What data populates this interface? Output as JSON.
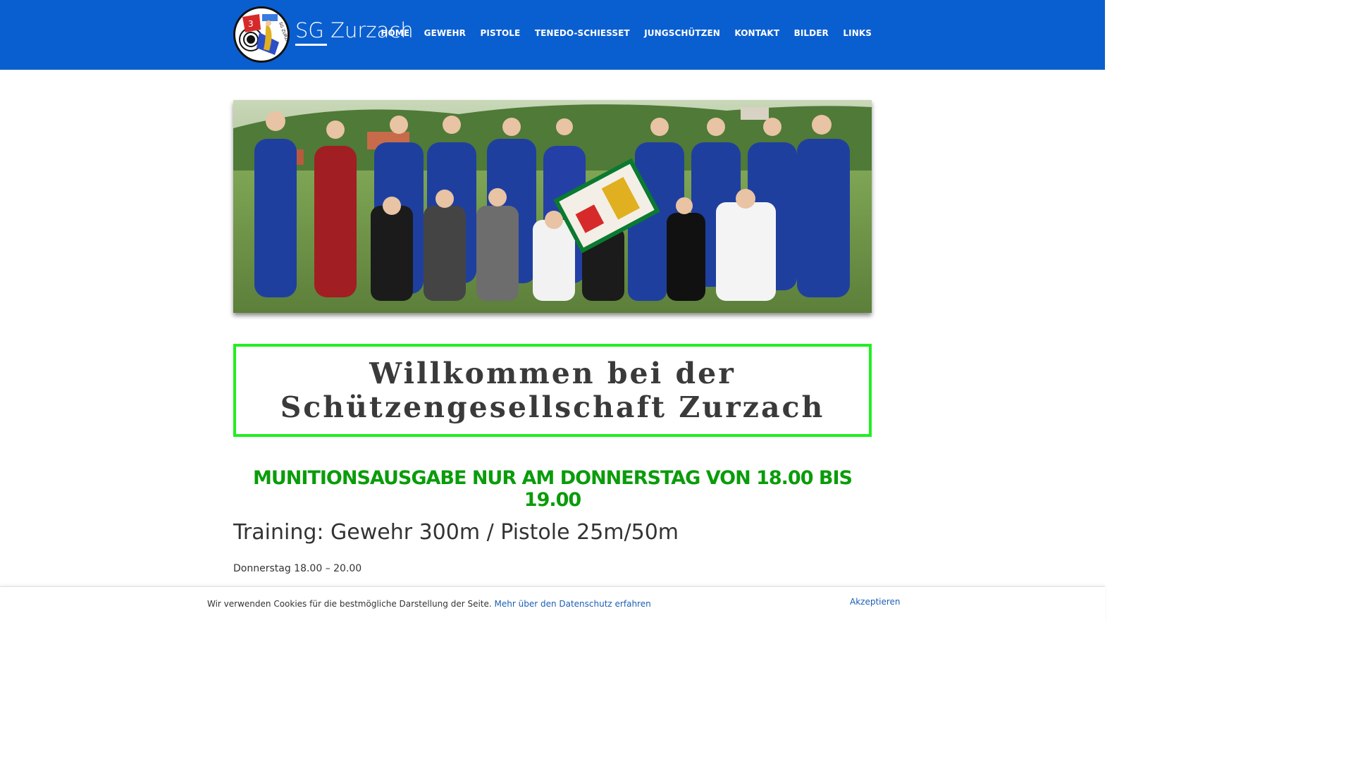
{
  "header": {
    "site_title": "SG Zurzach",
    "logo_text": "SG ZURZACH",
    "logo_number": "3",
    "nav": [
      {
        "label": "HOME"
      },
      {
        "label": "GEWEHR"
      },
      {
        "label": "PISTOLE"
      },
      {
        "label": "TENEDO-SCHIESSET"
      },
      {
        "label": "JUNGSCHÜTZEN"
      },
      {
        "label": "KONTAKT"
      },
      {
        "label": "BILDER"
      },
      {
        "label": "LINKS"
      }
    ]
  },
  "main": {
    "welcome_title": "Willkommen bei der Schützengesellschaft Zurzach",
    "notice": "MUNITIONSAUSGABE NUR AM DONNERSTAG VON 18.00 BIS 19.00",
    "training_title": "Training: Gewehr 300m / Pistole 25m/50m",
    "training_time": "Donnerstag 18.00 – 20.00"
  },
  "cookie_bar": {
    "text": "Wir verwenden Cookies für die bestmögliche Darstellung der Seite.",
    "link_label": "Mehr über den Datenschutz erfahren",
    "accept_label": "Akzeptieren"
  },
  "colors": {
    "header_bg": "#0a5fd0",
    "welcome_border": "#22ee22",
    "notice_green": "#0a9c0a",
    "link_blue": "#1a5fb4"
  }
}
